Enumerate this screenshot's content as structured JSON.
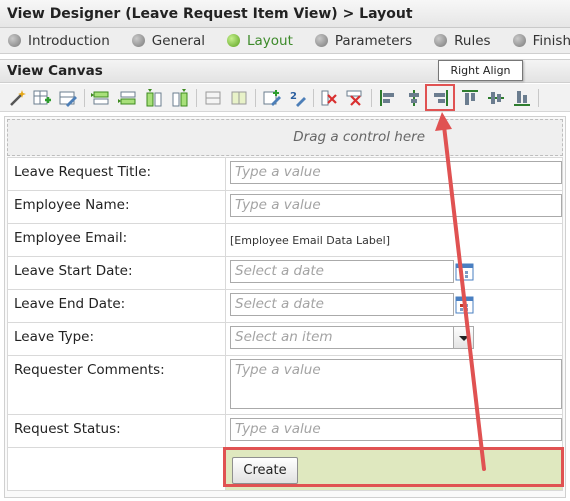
{
  "window": {
    "title": "View Designer (Leave Request Item View) > Layout"
  },
  "steps": [
    {
      "label": "Introduction",
      "active": false
    },
    {
      "label": "General",
      "active": false
    },
    {
      "label": "Layout",
      "active": true
    },
    {
      "label": "Parameters",
      "active": false
    },
    {
      "label": "Rules",
      "active": false
    },
    {
      "label": "Finished",
      "active": false
    }
  ],
  "canvas": {
    "title": "View Canvas",
    "drop_hint": "Drag a control here"
  },
  "toolbar": {
    "tooltip": "Right Align",
    "highlighted_button": "align-right-icon"
  },
  "form": {
    "rows": [
      {
        "label": "Leave Request Title:",
        "control": "text",
        "placeholder": "Type a value"
      },
      {
        "label": "Employee Name:",
        "control": "text",
        "placeholder": "Type a value"
      },
      {
        "label": "Employee Email:",
        "control": "data-label",
        "value": "[Employee Email Data Label]"
      },
      {
        "label": "Leave Start Date:",
        "control": "date",
        "placeholder": "Select a date"
      },
      {
        "label": "Leave End Date:",
        "control": "date",
        "placeholder": "Select a date"
      },
      {
        "label": "Leave Type:",
        "control": "dropdown",
        "placeholder": "Select an item"
      },
      {
        "label": "Requester Comments:",
        "control": "textarea",
        "placeholder": "Type a value"
      },
      {
        "label": "Request Status:",
        "control": "text",
        "placeholder": "Type a value"
      }
    ],
    "create_label": "Create"
  },
  "colors": {
    "highlight": "#e05252",
    "active_step": "#5aa11e",
    "create_cell": "#dfe8bf"
  }
}
